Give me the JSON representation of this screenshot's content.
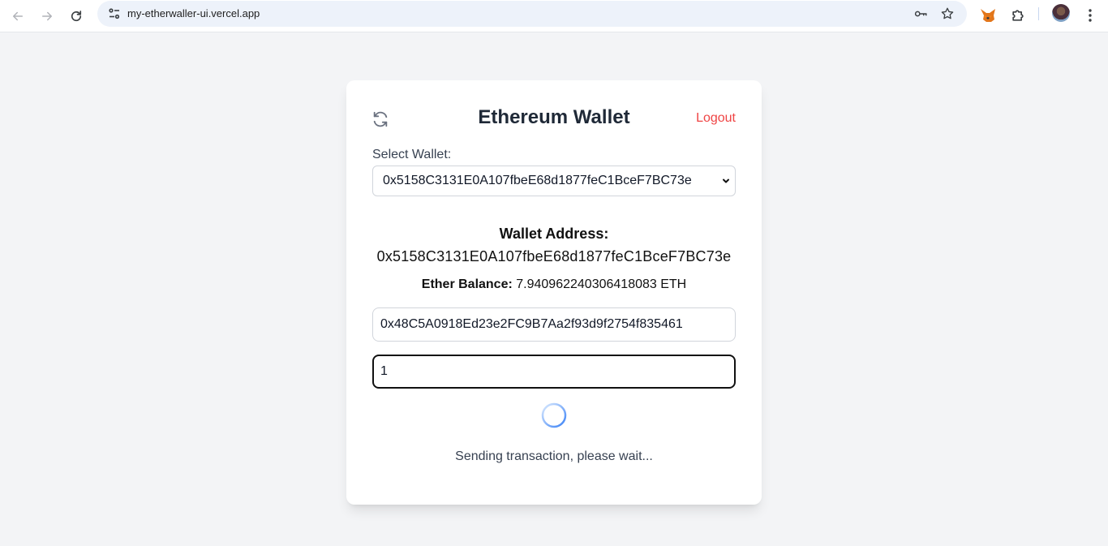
{
  "browser": {
    "url": "my-etherwaller-ui.vercel.app",
    "nav_icons": [
      "back-arrow-icon",
      "forward-arrow-icon",
      "reload-icon"
    ],
    "omnibox_icons": [
      "site-info-icon",
      "password-key-icon",
      "bookmark-star-icon"
    ],
    "toolbar_icons": [
      "metamask-fox-icon",
      "extensions-puzzle-icon",
      "profile-avatar",
      "more-menu-icon"
    ]
  },
  "wallet": {
    "title": "Ethereum Wallet",
    "refresh_icon": "refresh-icon",
    "logout_label": "Logout",
    "select_label": "Select Wallet:",
    "selected_wallet": "0x5158C3131E0A107fbeE68d1877feC1BceF7BC73e",
    "address_label": "Wallet Address:",
    "address_value": "0x5158C3131E0A107fbeE68d1877feC1BceF7BC73e",
    "balance_label": "Ether Balance:",
    "balance_value": "7.940962240306418083 ETH",
    "recipient_value": "0x48C5A0918Ed23e2FC9B7Aa2f93d9f2754f835461",
    "amount_value": "1",
    "status_text": "Sending transaction, please wait..."
  },
  "colors": {
    "page_bg": "#f3f4f6",
    "logout": "#ef4444",
    "spinner": "#3b82f6",
    "title": "#1f2937"
  }
}
